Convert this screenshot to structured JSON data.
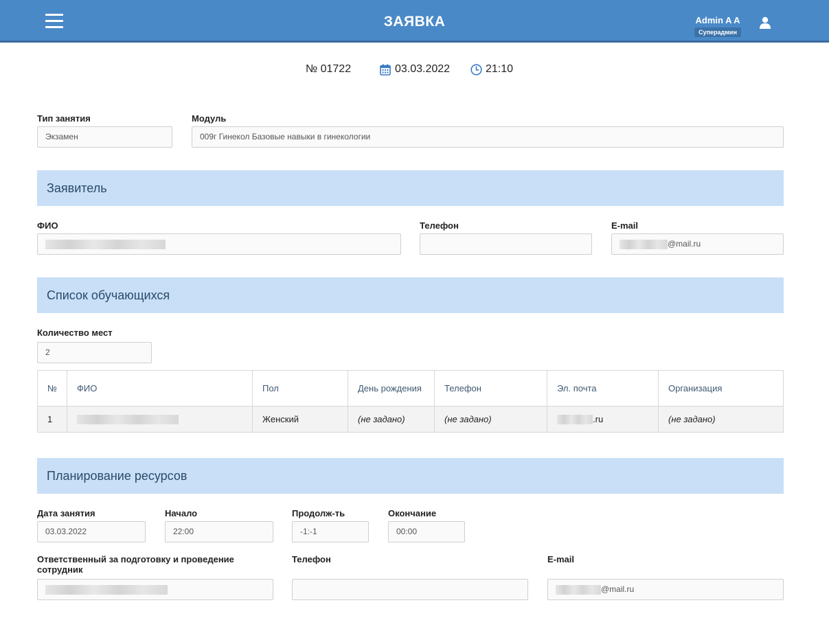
{
  "header": {
    "title": "ЗАЯВКА",
    "user_name": "Admin A A",
    "user_role": "Суперадмин"
  },
  "info": {
    "number": "№ 01722",
    "date": "03.03.2022",
    "time": "21:10"
  },
  "top_fields": {
    "lesson_type_label": "Тип занятия",
    "lesson_type_value": "Экзамен",
    "module_label": "Модуль",
    "module_value": "009г Гинекол Базовые навыки в гинекологии"
  },
  "applicant": {
    "section_title": "Заявитель",
    "fio_label": "ФИО",
    "phone_label": "Телефон",
    "email_label": "E-mail",
    "email_value": "@mail.ru"
  },
  "students": {
    "section_title": "Список обучающихся",
    "seats_label": "Количество мест",
    "seats_value": "2",
    "columns": [
      "№",
      "ФИО",
      "Пол",
      "День рождения",
      "Телефон",
      "Эл. почта",
      "Организация"
    ],
    "rows": [
      {
        "num": "1",
        "gender": "Женский",
        "birthday": "(не задано)",
        "phone": "(не задано)",
        "email": ".ru",
        "org": "(не задано)"
      }
    ]
  },
  "resources": {
    "section_title": "Планирование ресурсов",
    "date_label": "Дата занятия",
    "date_value": "03.03.2022",
    "start_label": "Начало",
    "start_value": "22:00",
    "duration_label": "Продолж-ть",
    "duration_value": "-1:-1",
    "end_label": "Окончание",
    "end_value": "00:00",
    "responsible_label": "Ответственный за подготовку и проведение сотрудник",
    "phone_label": "Телефон",
    "email_label": "E-mail",
    "email_value": "@mail.ru"
  }
}
